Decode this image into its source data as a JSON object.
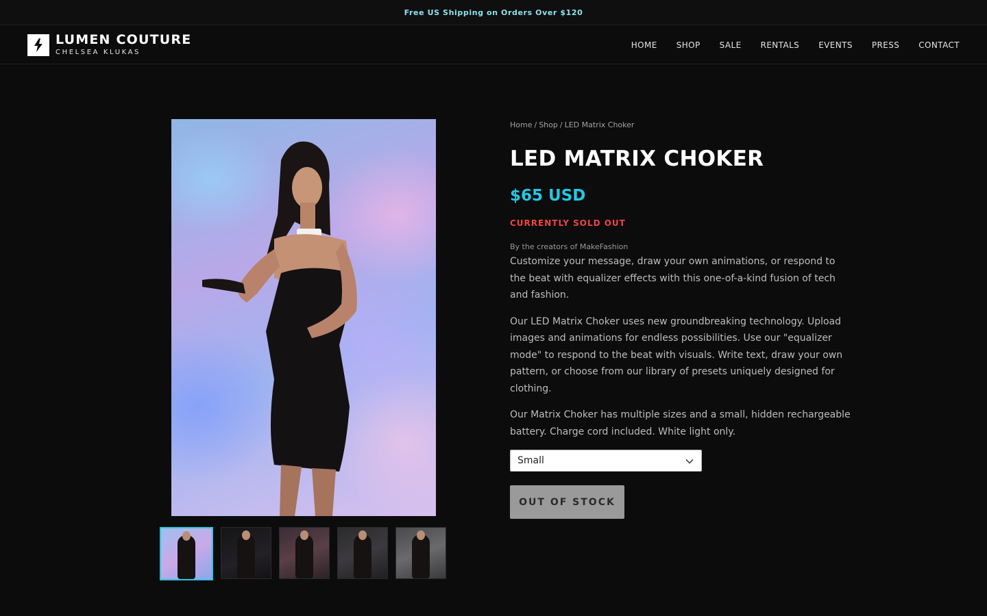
{
  "announcement": "Free US Shipping on Orders Over $120",
  "brand": {
    "title": "LUMEN COUTURE",
    "subtitle": "CHELSEA KLUKAS",
    "logo_icon": "lightning-bolt-icon"
  },
  "nav": [
    "HOME",
    "SHOP",
    "SALE",
    "RENTALS",
    "EVENTS",
    "PRESS",
    "CONTACT"
  ],
  "breadcrumb": [
    "Home",
    "Shop",
    "LED Matrix Choker"
  ],
  "product": {
    "title": "LED MATRIX CHOKER",
    "price": "$65 USD",
    "status": "CURRENTLY SOLD OUT",
    "byline": "By the creators of MakeFashion",
    "description": [
      "Customize your message, draw your own animations, or respond to the beat with equalizer effects with this one-of-a-kind fusion of tech and fashion.",
      "Our LED Matrix Choker uses new groundbreaking technology. Upload images and animations for endless possibilities. Use our \"equalizer mode\" to respond to the beat with visuals. Write text, draw your own pattern, or choose from our library of presets uniquely designed for clothing.",
      "Our Matrix Choker has multiple sizes and a small, hidden rechargeable battery. Charge cord included. White light only."
    ],
    "size_selected": "Small",
    "button_label": "OUT OF STOCK",
    "thumbnail_count": 5
  },
  "colors": {
    "accent": "#23c9e4",
    "sold_out": "#f0443f",
    "background": "#0c0c0d",
    "announcement_text": "#8fe4ec"
  }
}
